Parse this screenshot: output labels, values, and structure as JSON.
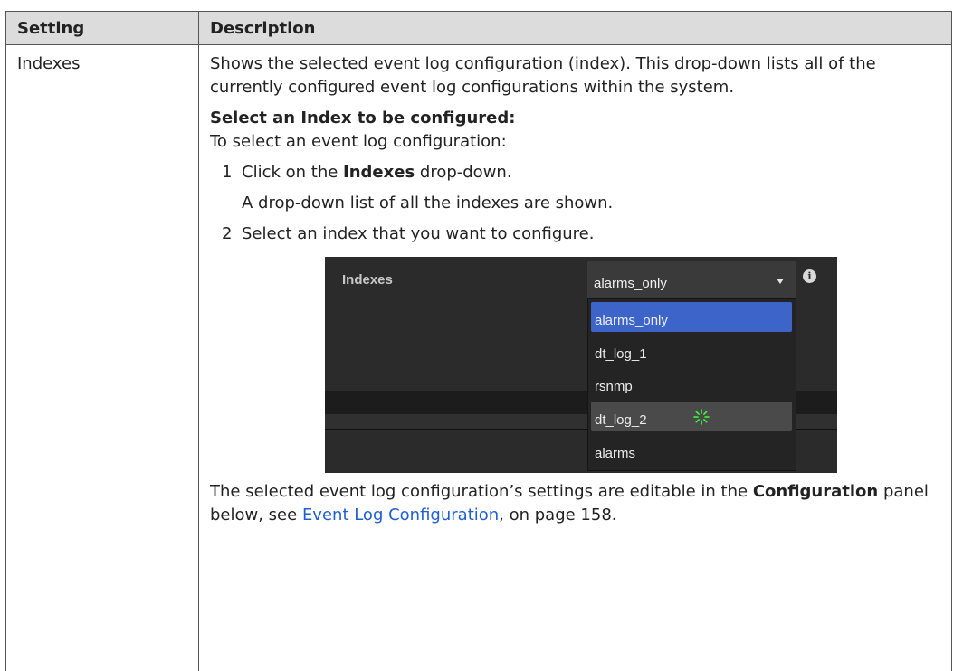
{
  "table": {
    "headers": [
      "Setting",
      "Description"
    ],
    "row": {
      "setting": "Indexes",
      "intro": "Shows the selected event log configuration (index). This drop-down lists all of the currently configured event log configurations within the system.",
      "section_heading": "Select an Index to be configured:",
      "lead": "To select an event log configuration:",
      "step1": {
        "num": "1",
        "pre": "Click on the ",
        "bold": "Indexes",
        "post": " drop-down."
      },
      "step1_note": "A drop-down list of all the indexes are shown.",
      "step2": {
        "num": "2",
        "text": "Select an index that you want to configure."
      },
      "outro": {
        "pre": "The selected event log configuration’s settings are editable in the ",
        "bold": "Configuration",
        "mid": " panel below, see ",
        "link": "Event Log Configuration",
        "post": ", on page 158."
      }
    }
  },
  "screenshot": {
    "label": "Indexes",
    "selected_value": "alarms_only",
    "options": [
      "alarms_only",
      "dt_log_1",
      "rsnmp",
      "dt_log_2",
      "alarms"
    ],
    "highlighted_option": "alarms_only",
    "hovered_option": "dt_log_2",
    "icons": {
      "dropdown": "chevron-down-icon",
      "info": "info-icon",
      "loading": "spinner-icon"
    },
    "colors": {
      "selected_bg": "#3d64c9",
      "spinner": "#3cff3c",
      "link": "#1f5fd4"
    }
  }
}
